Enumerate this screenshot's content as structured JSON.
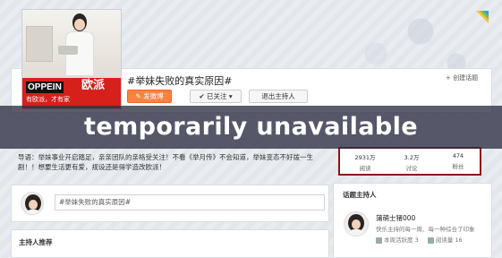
{
  "topic": {
    "title": "#举妹失败的真实原因#",
    "post_button": "发微博",
    "follow_button": "已关注",
    "exit_button": "退出主持人",
    "create_link": "创建话题"
  },
  "cover": {
    "brand_en": "OPPEIN",
    "brand_cn": "欧派",
    "slogan": "有欧派，才有家"
  },
  "guide": {
    "text": "导语：举妹事业开启踏足，亲亲团队的亲格受关注！不看《举月传》不会知道，举妹变态不好拨一生剧！！想要生活更有爱，规设还是得学造改欧派！"
  },
  "compose": {
    "placeholder": "#举妹失败的真实原因#"
  },
  "section": {
    "host_recommend": "主持人推荐"
  },
  "stats": {
    "items": [
      {
        "value": "2931万",
        "label": "阅读"
      },
      {
        "value": "3.2万",
        "label": "讨论"
      },
      {
        "value": "474",
        "label": "粉丝"
      }
    ]
  },
  "host_panel": {
    "heading": "话题主持人",
    "name": "蒲萌士猪000",
    "desc": "快乐主持的每一周、每一种综合了印象",
    "stat1": "本周活跃度 3",
    "stat2": "阅读量 16"
  },
  "overlay": {
    "text": "temporarily unavailable"
  },
  "colors": {
    "accent_orange": "#ff8140",
    "stats_border": "#8a1416",
    "brand_red": "#d5201b",
    "overlay": "#2d2e42"
  }
}
